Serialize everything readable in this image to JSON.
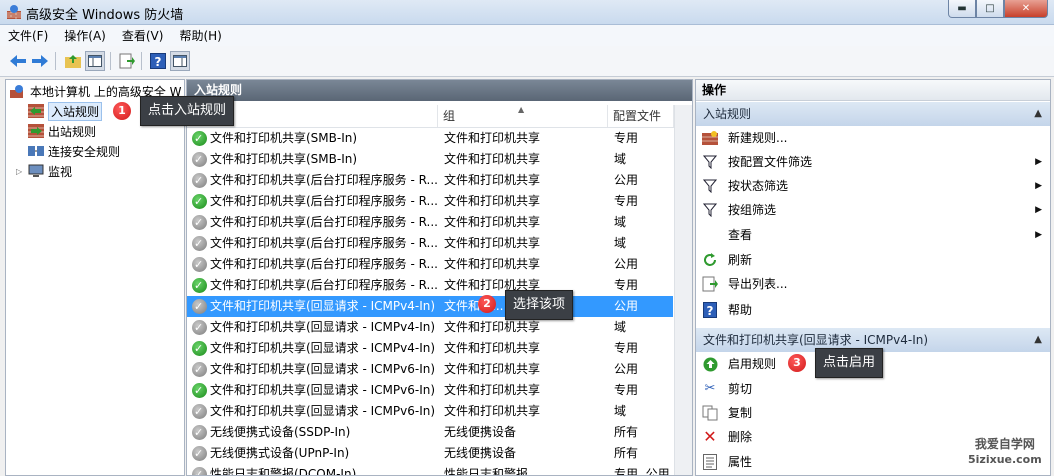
{
  "window": {
    "title": "高级安全 Windows 防火墙",
    "btn_min": "▬",
    "btn_max": "□",
    "btn_close": "✕"
  },
  "menu": [
    "文件(F)",
    "操作(A)",
    "查看(V)",
    "帮助(H)"
  ],
  "tree": {
    "root": "本地计算机 上的高级安全 W",
    "items": [
      "入站规则",
      "出站规则",
      "连接安全规则",
      "监视"
    ]
  },
  "center": {
    "header": "入站规则",
    "columns": [
      "名称",
      "组",
      "配置文件"
    ],
    "rows": [
      {
        "enabled": true,
        "name": "文件和打印机共享(SMB-In)",
        "group": "文件和打印机共享",
        "profile": "专用"
      },
      {
        "enabled": false,
        "name": "文件和打印机共享(SMB-In)",
        "group": "文件和打印机共享",
        "profile": "域"
      },
      {
        "enabled": false,
        "name": "文件和打印机共享(后台打印程序服务 - R...",
        "group": "文件和打印机共享",
        "profile": "公用"
      },
      {
        "enabled": true,
        "name": "文件和打印机共享(后台打印程序服务 - R...",
        "group": "文件和打印机共享",
        "profile": "专用"
      },
      {
        "enabled": false,
        "name": "文件和打印机共享(后台打印程序服务 - R...",
        "group": "文件和打印机共享",
        "profile": "域"
      },
      {
        "enabled": false,
        "name": "文件和打印机共享(后台打印程序服务 - R...",
        "group": "文件和打印机共享",
        "profile": "域"
      },
      {
        "enabled": false,
        "name": "文件和打印机共享(后台打印程序服务 - R...",
        "group": "文件和打印机共享",
        "profile": "公用"
      },
      {
        "enabled": true,
        "name": "文件和打印机共享(后台打印程序服务 - R...",
        "group": "文件和打印机共享",
        "profile": "专用"
      },
      {
        "enabled": false,
        "name": "文件和打印机共享(回显请求 - ICMPv4-In)",
        "group": "文件和打...",
        "profile": "公用",
        "selected": true
      },
      {
        "enabled": false,
        "name": "文件和打印机共享(回显请求 - ICMPv4-In)",
        "group": "文件和打印机共享",
        "profile": "域"
      },
      {
        "enabled": true,
        "name": "文件和打印机共享(回显请求 - ICMPv4-In)",
        "group": "文件和打印机共享",
        "profile": "专用"
      },
      {
        "enabled": false,
        "name": "文件和打印机共享(回显请求 - ICMPv6-In)",
        "group": "文件和打印机共享",
        "profile": "公用"
      },
      {
        "enabled": true,
        "name": "文件和打印机共享(回显请求 - ICMPv6-In)",
        "group": "文件和打印机共享",
        "profile": "专用"
      },
      {
        "enabled": false,
        "name": "文件和打印机共享(回显请求 - ICMPv6-In)",
        "group": "文件和打印机共享",
        "profile": "域"
      },
      {
        "enabled": false,
        "name": "无线便携式设备(SSDP-In)",
        "group": "无线便携设备",
        "profile": "所有"
      },
      {
        "enabled": false,
        "name": "无线便携式设备(UPnP-In)",
        "group": "无线便携设备",
        "profile": "所有"
      },
      {
        "enabled": false,
        "name": "性能日志和警报(DCOM-In)",
        "group": "性能日志和警报",
        "profile": "专用, 公用"
      }
    ]
  },
  "actions": {
    "title": "操作",
    "section1": {
      "label": "入站规则",
      "items": [
        "新建规则...",
        "按配置文件筛选",
        "按状态筛选",
        "按组筛选",
        "查看",
        "刷新",
        "导出列表...",
        "帮助"
      ]
    },
    "section2": {
      "label": "文件和打印机共享(回显请求 - ICMPv4-In)",
      "items": [
        "启用规则",
        "剪切",
        "复制",
        "删除",
        "属性"
      ]
    }
  },
  "callouts": [
    {
      "num": "1",
      "text": "点击入站规则"
    },
    {
      "num": "2",
      "text": "选择该项"
    },
    {
      "num": "3",
      "text": "点击启用"
    }
  ],
  "watermark": {
    "line1": "我爱自学网",
    "line2": "5izixue.com"
  },
  "colors": {
    "selection": "#3399ff",
    "pane_header": "#6a7685",
    "enabled": "#1a8a1a",
    "disabled": "#7d7d7d",
    "badge": "#d11a1a"
  }
}
